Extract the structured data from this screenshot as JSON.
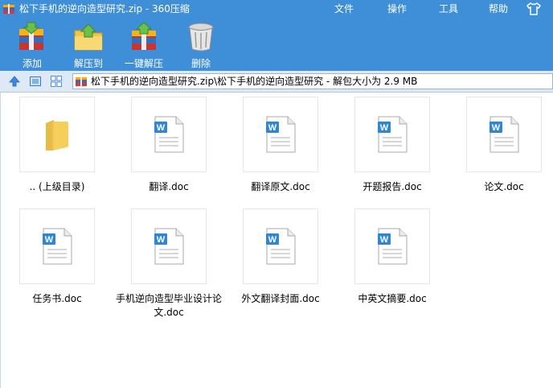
{
  "window": {
    "title": "松下手机的逆向造型研究.zip - 360压缩",
    "menu": [
      "文件",
      "操作",
      "工具",
      "帮助"
    ]
  },
  "toolbar": {
    "add_label": "添加",
    "extract_to_label": "解压到",
    "one_click_extract_label": "一键解压",
    "delete_label": "删除"
  },
  "address": {
    "path": "松下手机的逆向造型研究.zip\\松下手机的逆向造型研究 - 解包大小为 2.9 MB"
  },
  "files": [
    {
      "name": ".. (上级目录)",
      "type": "folder"
    },
    {
      "name": "翻译.doc",
      "type": "doc"
    },
    {
      "name": "翻译原文.doc",
      "type": "doc"
    },
    {
      "name": "开题报告.doc",
      "type": "doc"
    },
    {
      "name": "论文.doc",
      "type": "doc"
    },
    {
      "name": "任务书.doc",
      "type": "doc"
    },
    {
      "name": "手机逆向造型毕业设计论文.doc",
      "type": "doc"
    },
    {
      "name": "外文翻译封面.doc",
      "type": "doc"
    },
    {
      "name": "中英文摘要.doc",
      "type": "doc"
    }
  ],
  "colors": {
    "titlebar": "#3f8fd8",
    "address_bg": "#dde9f6",
    "doc_blue": "#2e86d6"
  }
}
